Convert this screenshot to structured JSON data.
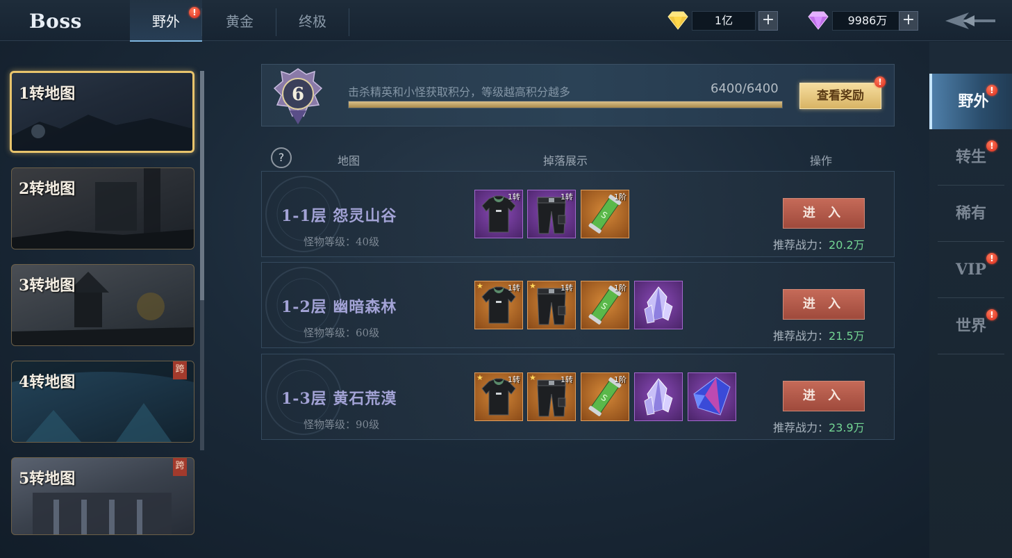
{
  "header": {
    "title": "Boss",
    "tabs": [
      {
        "label": "野外",
        "active": true,
        "alert": "!"
      },
      {
        "label": "黄金",
        "active": false
      },
      {
        "label": "终极",
        "active": false
      }
    ],
    "currency": [
      {
        "icon": "gold-diamond-icon",
        "value": "1亿"
      },
      {
        "icon": "purple-diamond-icon",
        "value": "9986万"
      }
    ],
    "plus_label": "+"
  },
  "maps": [
    {
      "label": "1转地图",
      "active": true
    },
    {
      "label": "2转地图"
    },
    {
      "label": "3转地图"
    },
    {
      "label": "4转地图",
      "badge": "跨"
    },
    {
      "label": "5转地图",
      "badge": "跨"
    }
  ],
  "score": {
    "level": "6",
    "description": "击杀精英和小怪获取积分，等级越高积分越多",
    "value_text": "6400/6400",
    "progress": 1.0,
    "reward_button": "查看奖励",
    "alert": "!"
  },
  "table": {
    "help": "?",
    "headers": {
      "map": "地图",
      "drops": "掉落展示",
      "action": "操作"
    },
    "rows": [
      {
        "name": "1-1层  怨灵山谷",
        "level": "怪物等级：40级",
        "items": [
          {
            "type": "shirt",
            "rarity": "purple",
            "tag": "1转"
          },
          {
            "type": "pants",
            "rarity": "purple",
            "tag": "1转"
          },
          {
            "type": "scroll",
            "rarity": "orange",
            "tag": "1阶"
          }
        ],
        "enter": "进 入",
        "power_label": "推荐战力：",
        "power_value": "20.2万"
      },
      {
        "name": "1-2层  幽暗森林",
        "level": "怪物等级：60级",
        "items": [
          {
            "type": "shirt",
            "rarity": "orange",
            "tag": "1转",
            "star": true
          },
          {
            "type": "pants",
            "rarity": "orange",
            "tag": "1转",
            "star": true
          },
          {
            "type": "scroll",
            "rarity": "orange",
            "tag": "1阶"
          },
          {
            "type": "crystal",
            "rarity": "purple"
          }
        ],
        "enter": "进 入",
        "power_label": "推荐战力：",
        "power_value": "21.5万"
      },
      {
        "name": "1-3层  黄石荒漠",
        "level": "怪物等级：90级",
        "items": [
          {
            "type": "shirt",
            "rarity": "orange",
            "tag": "1转",
            "star": true
          },
          {
            "type": "pants",
            "rarity": "orange",
            "tag": "1转",
            "star": true
          },
          {
            "type": "scroll",
            "rarity": "orange",
            "tag": "1阶"
          },
          {
            "type": "crystal",
            "rarity": "purple"
          },
          {
            "type": "gem",
            "rarity": "purple"
          }
        ],
        "enter": "进 入",
        "power_label": "推荐战力：",
        "power_value": "23.9万"
      }
    ]
  },
  "side_nav": [
    {
      "label": "野外",
      "active": true,
      "alert": "!"
    },
    {
      "label": "转生",
      "alert": "!"
    },
    {
      "label": "稀有"
    },
    {
      "label": "VIP",
      "alert": "!"
    },
    {
      "label": "世界",
      "alert": "!"
    }
  ]
}
